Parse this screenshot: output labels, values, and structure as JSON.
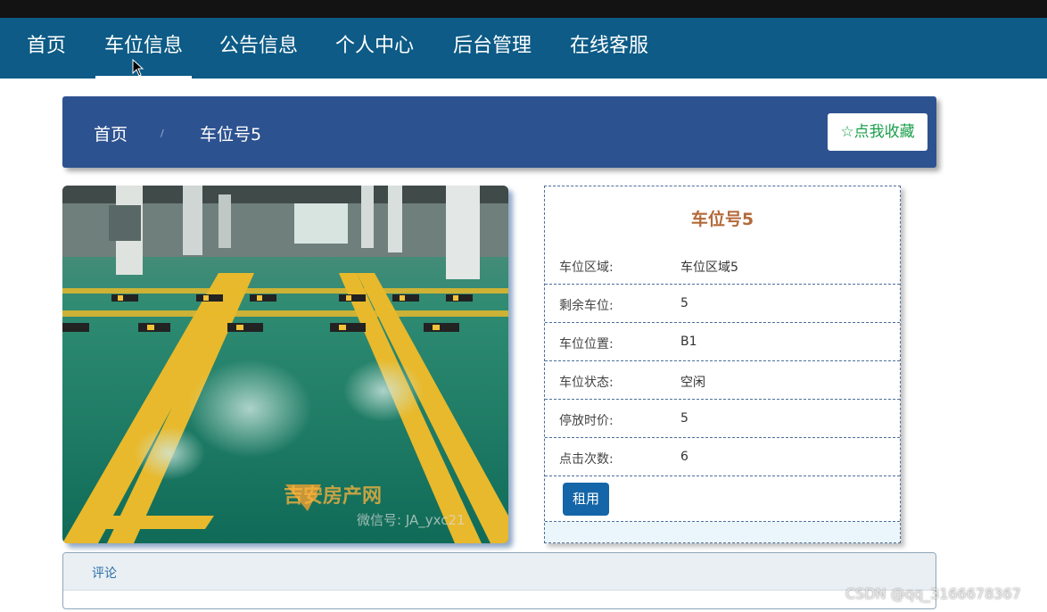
{
  "nav": {
    "items": [
      {
        "label": "首页"
      },
      {
        "label": "车位信息",
        "active": true
      },
      {
        "label": "公告信息"
      },
      {
        "label": "个人中心"
      },
      {
        "label": "后台管理"
      },
      {
        "label": "在线客服"
      }
    ]
  },
  "breadcrumb": {
    "home": "首页",
    "separator": "/",
    "current": "车位号5"
  },
  "favorite_button": "☆点我收藏",
  "photo": {
    "watermark": "吉安房产网",
    "watermark_sub": "微信号: JA_yxc21"
  },
  "detail": {
    "title": "车位号5",
    "rows": [
      {
        "label": "车位区域:",
        "value": "车位区域5"
      },
      {
        "label": "剩余车位:",
        "value": "5"
      },
      {
        "label": "车位位置:",
        "value": "B1"
      },
      {
        "label": "车位状态:",
        "value": "空闲"
      },
      {
        "label": "停放时价:",
        "value": "5"
      },
      {
        "label": "点击次数:",
        "value": "6"
      }
    ],
    "rent_button": "租用"
  },
  "comments": {
    "title": "评论"
  },
  "watermark_corner": "CSDN @qq_3166678367",
  "colors": {
    "nav_bg": "#0d5b86",
    "breadcrumb_bg": "#2d5290",
    "title_color": "#b46a3a",
    "favorite_color": "#1aa04a",
    "rent_button_bg": "#1566a8"
  }
}
